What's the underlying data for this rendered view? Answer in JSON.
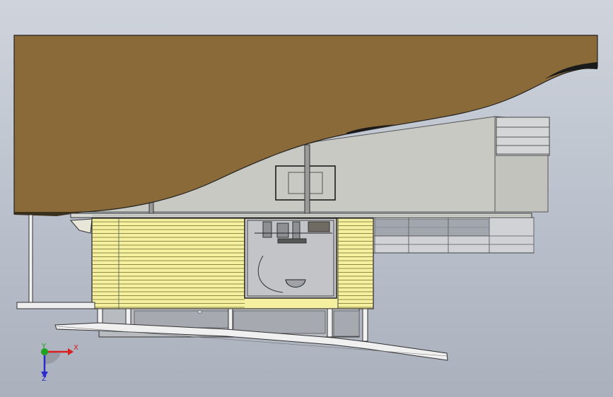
{
  "view": {
    "kind": "cad-elevation-view",
    "colors": {
      "background_top": "#cfd4dc",
      "background_bottom": "#aab1bd",
      "terrain": "#8b6a3a",
      "wall": "#c9c9c4",
      "cladding": "#f5f0a0",
      "cladding_lines": "#6b6a2a",
      "glazing": "#a9adb5",
      "outline": "#1a1a1a"
    }
  },
  "triad": {
    "x_label": "X",
    "y_label": "Y",
    "z_label": "Z",
    "x_color": "#d81e1e",
    "y_color": "#1da31d",
    "z_color": "#2a2ad0",
    "icons": [
      "x-axis-arrow-icon",
      "y-axis-arrow-icon",
      "z-axis-arrow-icon"
    ]
  }
}
